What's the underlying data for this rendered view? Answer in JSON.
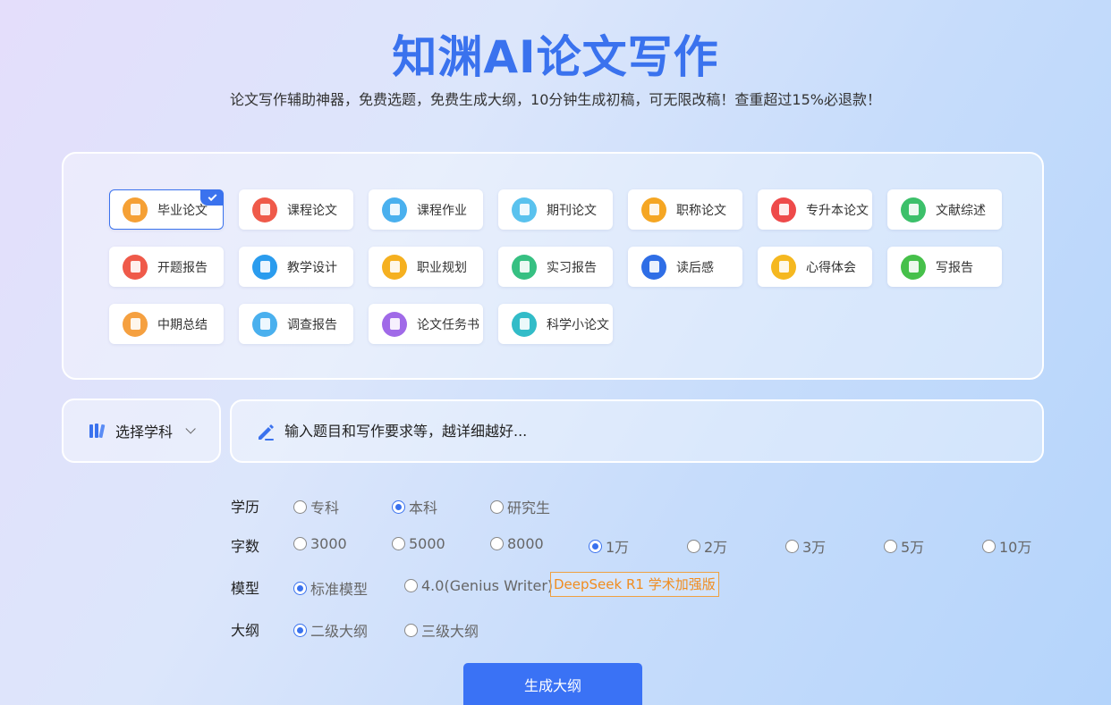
{
  "header": {
    "title": "知渊AI论文写作",
    "subtitle": "论文写作辅助神器，免费选题，免费生成大纲，10分钟生成初稿，可无限改稿！查重超过15%必退款！"
  },
  "paper_types": [
    {
      "label": "毕业论文",
      "icon": "graduation-cap-icon",
      "color": "#f5a035",
      "selected": true
    },
    {
      "label": "课程论文",
      "icon": "book-icon",
      "color": "#ef5a4a"
    },
    {
      "label": "课程作业",
      "icon": "document-icon",
      "color": "#4ab0ee"
    },
    {
      "label": "期刊论文",
      "icon": "journal-icon",
      "color": "#5ac2ee"
    },
    {
      "label": "职称论文",
      "icon": "certificate-icon",
      "color": "#f5a623"
    },
    {
      "label": "专升本论文",
      "icon": "printer-icon",
      "color": "#ee4a4a"
    },
    {
      "label": "文献综述",
      "icon": "open-book-icon",
      "color": "#3cc06a"
    },
    {
      "label": "开题报告",
      "icon": "report-icon",
      "color": "#ef5a4a"
    },
    {
      "label": "教学设计",
      "icon": "pencil-ruler-icon",
      "color": "#2a9cee"
    },
    {
      "label": "职业规划",
      "icon": "tie-icon",
      "color": "#f5b020"
    },
    {
      "label": "实习报告",
      "icon": "list-icon",
      "color": "#36c082"
    },
    {
      "label": "读后感",
      "icon": "chat-bubble-icon",
      "color": "#2f6ee6"
    },
    {
      "label": "心得体会",
      "icon": "notebook-icon",
      "color": "#f5b820"
    },
    {
      "label": "写报告",
      "icon": "edit-doc-icon",
      "color": "#46c04a"
    },
    {
      "label": "中期总结",
      "icon": "summary-icon",
      "color": "#f5a040"
    },
    {
      "label": "调查报告",
      "icon": "survey-icon",
      "color": "#4ab0ee"
    },
    {
      "label": "论文任务书",
      "icon": "task-book-icon",
      "color": "#a06ae8"
    },
    {
      "label": "科学小论文",
      "icon": "flask-icon",
      "color": "#32bcc8"
    }
  ],
  "subject": {
    "label": "选择学科",
    "icon": "books-icon"
  },
  "topic": {
    "placeholder": "输入题目和写作要求等，越详细越好..."
  },
  "options": {
    "education": {
      "label": "学历",
      "items": [
        {
          "label": "专科",
          "checked": false
        },
        {
          "label": "本科",
          "checked": true
        },
        {
          "label": "研究生",
          "checked": false
        }
      ]
    },
    "word_count": {
      "label": "字数",
      "items": [
        {
          "label": "3000",
          "checked": false
        },
        {
          "label": "5000",
          "checked": false
        },
        {
          "label": "8000",
          "checked": false
        },
        {
          "label": "1万",
          "checked": true
        },
        {
          "label": "2万",
          "checked": false
        },
        {
          "label": "3万",
          "checked": false
        },
        {
          "label": "5万",
          "checked": false
        },
        {
          "label": "10万",
          "checked": false
        }
      ]
    },
    "model": {
      "label": "模型",
      "items": [
        {
          "label": "标准模型",
          "checked": true
        },
        {
          "label": "4.0(Genius Writer)",
          "checked": false
        }
      ],
      "badge": "DeepSeek R1 学术加强版"
    },
    "outline": {
      "label": "大纲",
      "items": [
        {
          "label": "二级大纲",
          "checked": true
        },
        {
          "label": "三级大纲",
          "checked": false
        }
      ]
    }
  },
  "generate_button": {
    "label": "生成大纲"
  },
  "colors": {
    "accent": "#3a72ee",
    "badge": "#f08c1e"
  }
}
